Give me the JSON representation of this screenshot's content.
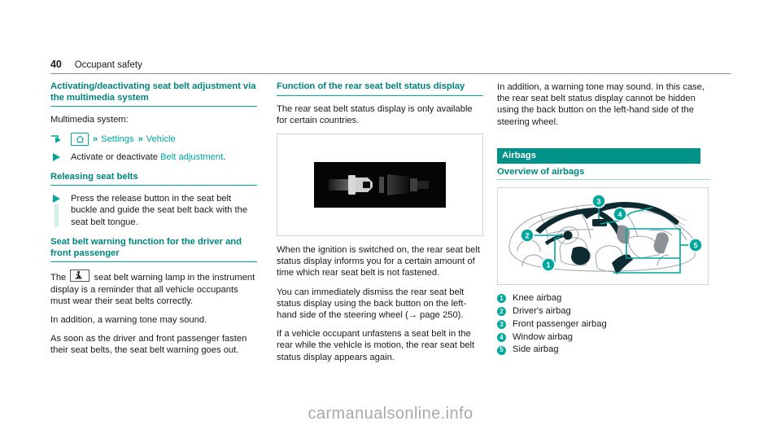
{
  "header": {
    "page_number": "40",
    "title": "Occupant safety"
  },
  "column1": {
    "heading1": "Activating/deactivating seat belt adjustment via the multimedia system",
    "intro": "Multimedia system:",
    "nav_path": {
      "arrow_icon": "hook-arrow-icon",
      "home_icon": "home-icon",
      "separator": "»",
      "step1": "Settings",
      "step2": "Vehicle"
    },
    "bullet1_prefix": "Activate or deactivate ",
    "bullet1_link": "Belt adjustment",
    "bullet1_suffix": ".",
    "heading2": "Releasing seat belts",
    "bullet2": "Press the release button in the seat belt buckle and guide the seat belt back with the seat belt tongue.",
    "heading3": "Seat belt warning function for the driver and front passenger",
    "para1_before": "The",
    "para1_icon": "seat-belt-warning-lamp-icon",
    "para1_after": "seat belt warning lamp in the instrument display is a reminder that all vehicle occupants must wear their seat belts correctly.",
    "para2": "In addition, a warning tone may sound.",
    "para3": "As soon as the driver and front passenger fasten their seat belts, the seat belt warning goes out."
  },
  "column2": {
    "heading1": "Function of the rear seat belt status display",
    "para1": "The rear seat belt status display is only available for certain countries.",
    "figure": {
      "name": "rear-seat-belt-status-display-image",
      "content": "seat-belt-buckle-indicator"
    },
    "para2": "When the ignition is switched on, the rear seat belt status display informs you for a certain amount of time which rear seat belt is not fastened.",
    "para3_a": "You can immediately dismiss the rear seat belt status display using the back button on the left-hand side of the steering wheel (",
    "para3_ref": "→ page 250",
    "para3_b": ").",
    "para4": "If a vehicle occupant unfastens a seat belt in the rear while the vehicle is motion, the rear seat belt status display appears again."
  },
  "column3": {
    "para1": "In addition, a warning tone may sound. In this case, the rear seat belt status display cannot be hidden using the back button on the left-hand side of the steering wheel.",
    "banner": "Airbags",
    "subheading": "Overview of airbags",
    "diagram_name": "airbag-overview-diagram",
    "legend": [
      {
        "num": "1",
        "label": "Knee airbag"
      },
      {
        "num": "2",
        "label": "Driver's airbag"
      },
      {
        "num": "3",
        "label": "Front passenger airbag"
      },
      {
        "num": "4",
        "label": "Window airbag"
      },
      {
        "num": "5",
        "label": "Side airbag"
      }
    ]
  },
  "watermark": "carmanualsonline.info",
  "colors": {
    "accent_teal": "#00a79d",
    "heading_teal": "#00857d",
    "banner_teal": "#009188",
    "pale_teal": "#cfeeec",
    "rule_gray": "#8c8c8c"
  }
}
